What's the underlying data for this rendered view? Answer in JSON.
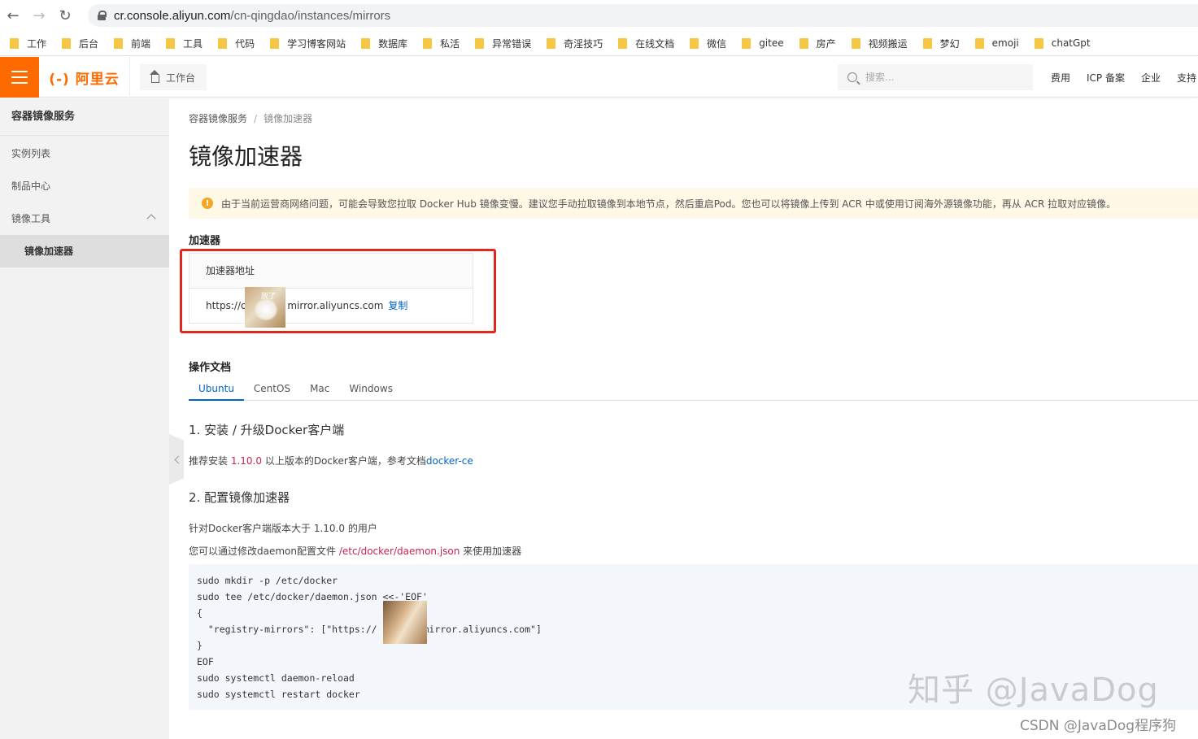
{
  "browser": {
    "url_host": "cr.console.aliyun.com",
    "url_path": "/cn-qingdao/instances/mirrors",
    "bookmarks": [
      "工作",
      "后台",
      "前端",
      "工具",
      "代码",
      "学习博客网站",
      "数据库",
      "私活",
      "异常错误",
      "奇淫技巧",
      "在线文档",
      "微信",
      "gitee",
      "房产",
      "视频搬运",
      "梦幻",
      "emoji",
      "chatGpt"
    ]
  },
  "topbar": {
    "logo": "(-) 阿里云",
    "workbench": "工作台",
    "search_placeholder": "搜索...",
    "links": [
      "费用",
      "ICP 备案",
      "企业",
      "支持"
    ]
  },
  "sidebar": {
    "title": "容器镜像服务",
    "items": [
      "实例列表",
      "制品中心",
      "镜像工具"
    ],
    "sub_item": "镜像加速器"
  },
  "main": {
    "breadcrumb": [
      "容器镜像服务",
      "/",
      "镜像加速器"
    ],
    "title": "镜像加速器",
    "notice": "由于当前运营商网络问题，可能会导致您拉取 Docker Hub 镜像变慢。建议您手动拉取镜像到本地节点，然后重启Pod。您也可以将镜像上传到 ACR 中或使用订阅海外源镜像功能，再从 ACR 拉取对应镜像。",
    "accel_section": "加速器",
    "accel_header": "加速器地址",
    "accel_url_prefix": "https://o",
    "accel_url_suffix": "mirror.aliyuncs.com",
    "mask_label": "脱了",
    "copy": "复制",
    "docs_section": "操作文档",
    "tabs": [
      "Ubuntu",
      "CentOS",
      "Mac",
      "Windows"
    ],
    "step1": "1. 安装 / 升级Docker客户端",
    "step1_text_a": "推荐安装 ",
    "step1_version": "1.10.0",
    "step1_text_b": " 以上版本的Docker客户端，参考文档",
    "step1_link": "docker-ce",
    "step2": "2. 配置镜像加速器",
    "step2_p1": "针对Docker客户端版本大于 1.10.0 的用户",
    "step2_p2_a": "您可以通过修改daemon配置文件 ",
    "step2_p2_path": "/etc/docker/daemon.json",
    "step2_p2_b": " 来使用加速器",
    "code": [
      "sudo mkdir -p /etc/docker",
      "sudo tee /etc/docker/daemon.json <<-'EOF'",
      "{",
      "  \"registry-mirrors\": [\"https://",
      "}",
      "EOF",
      "sudo systemctl daemon-reload",
      "sudo systemctl restart docker"
    ],
    "code_line4_suffix": ".mirror.aliyuncs.com\"]"
  },
  "watermark": {
    "main": "知乎 @JavaDog",
    "csdn": "CSDN @JavaDog程序狗"
  },
  "colors": {
    "brand": "#ff6a00",
    "link": "#0064c8",
    "highlight_frame": "#e0281f",
    "notice_bg": "#fff8e6"
  }
}
